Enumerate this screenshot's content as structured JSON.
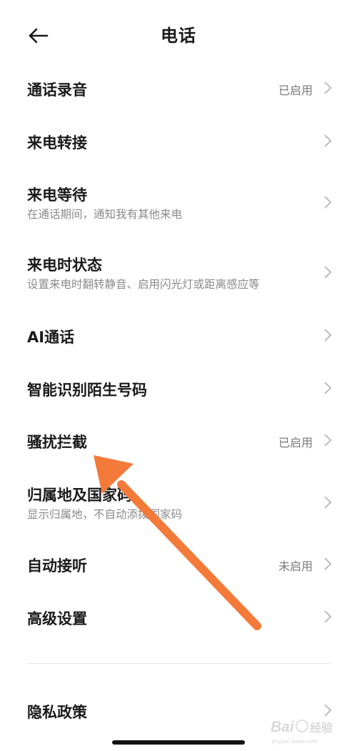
{
  "header": {
    "title": "电话",
    "back_icon": "arrow-left-icon"
  },
  "items": [
    {
      "label": "通话录音",
      "status": "已启用",
      "sub": ""
    },
    {
      "label": "来电转接",
      "status": "",
      "sub": ""
    },
    {
      "label": "来电等待",
      "status": "",
      "sub": "在通话期间，通知我有其他来电"
    },
    {
      "label": "来电时状态",
      "status": "",
      "sub": "设置来电时翻转静音、启用闪光灯或距离感应等"
    },
    {
      "label": "AI通话",
      "status": "",
      "sub": ""
    },
    {
      "label": "智能识别陌生号码",
      "status": "",
      "sub": ""
    },
    {
      "label": "骚扰拦截",
      "status": "已启用",
      "sub": ""
    },
    {
      "label": "归属地及国家码",
      "status": "",
      "sub": "显示归属地，不自动添拨国家码"
    },
    {
      "label": "自动接听",
      "status": "未启用",
      "sub": ""
    },
    {
      "label": "高级设置",
      "status": "",
      "sub": ""
    },
    {
      "label": "隐私政策",
      "status": "",
      "sub": ""
    }
  ],
  "annotation": {
    "color": "#f47a3a",
    "icon": "pointer-arrow"
  },
  "watermark": {
    "brand": "Bai",
    "brand_cn": "经验",
    "url": "jingyan.baidu.com"
  }
}
